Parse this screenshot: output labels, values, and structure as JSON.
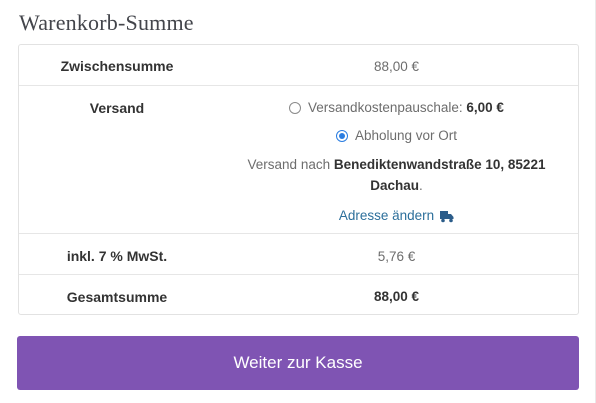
{
  "cart_totals": {
    "heading": "Warenkorb-Summe",
    "subtotal": {
      "label": "Zwischensumme",
      "value": "88,00 €"
    },
    "shipping": {
      "label": "Versand",
      "options": [
        {
          "label": "Versandkostenpauschale: ",
          "price": "6,00 €",
          "selected": false
        },
        {
          "label": "Abholung vor Ort",
          "price": "",
          "selected": true
        }
      ],
      "destination_prefix": "Versand nach ",
      "destination_line1": "Benediktenwandstraße 10, 85221",
      "destination_line2": "Dachau",
      "destination_suffix": ".",
      "change_address_label": "Adresse ändern",
      "change_address_icon": "truck-icon"
    },
    "tax": {
      "label": "inkl. 7 % MwSt.",
      "value": "5,76 €"
    },
    "total": {
      "label": "Gesamtsumme",
      "value": "88,00 €"
    }
  },
  "checkout_button": {
    "label": "Weiter zur Kasse"
  },
  "colors": {
    "accent": "#7f54b3",
    "link": "#2c6f9b",
    "radio_selected": "#2a7de1"
  }
}
